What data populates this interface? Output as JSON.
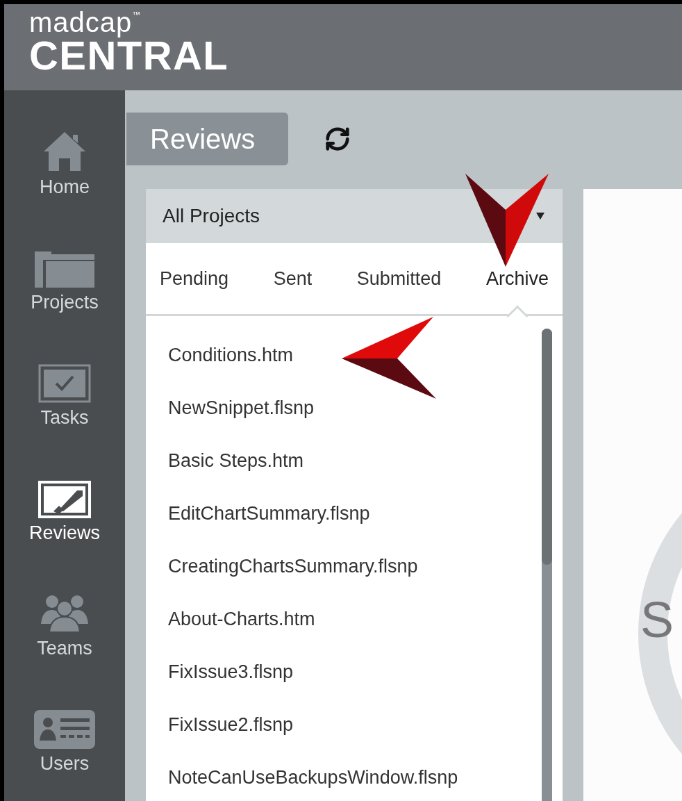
{
  "header": {
    "logo": {
      "brand": "madcap",
      "mark": "™",
      "product": "CENTRAL"
    }
  },
  "sidebar": {
    "items": [
      {
        "label": "Home",
        "kind": "home",
        "selected": false
      },
      {
        "label": "Projects",
        "kind": "projects",
        "selected": false
      },
      {
        "label": "Tasks",
        "kind": "tasks",
        "selected": false
      },
      {
        "label": "Reviews",
        "kind": "reviews",
        "selected": true
      },
      {
        "label": "Teams",
        "kind": "teams",
        "selected": false
      },
      {
        "label": "Users",
        "kind": "users",
        "selected": false
      }
    ]
  },
  "toolbar": {
    "title": "Reviews"
  },
  "project_filter": {
    "value": "All Projects"
  },
  "tabs": [
    {
      "label": "Pending",
      "selected": false
    },
    {
      "label": "Sent",
      "selected": false
    },
    {
      "label": "Submitted",
      "selected": false
    },
    {
      "label": "Archive",
      "selected": true
    }
  ],
  "files": [
    "Conditions.htm",
    "NewSnippet.flsnp",
    "Basic Steps.htm",
    "EditChartSummary.flsnp",
    "CreatingChartsSummary.flsnp",
    "About-Charts.htm",
    "FixIssue3.flsnp",
    "FixIssue2.flsnp",
    "NoteCanUseBackupsWindow.flsnp"
  ],
  "detail": {
    "text": "S"
  }
}
